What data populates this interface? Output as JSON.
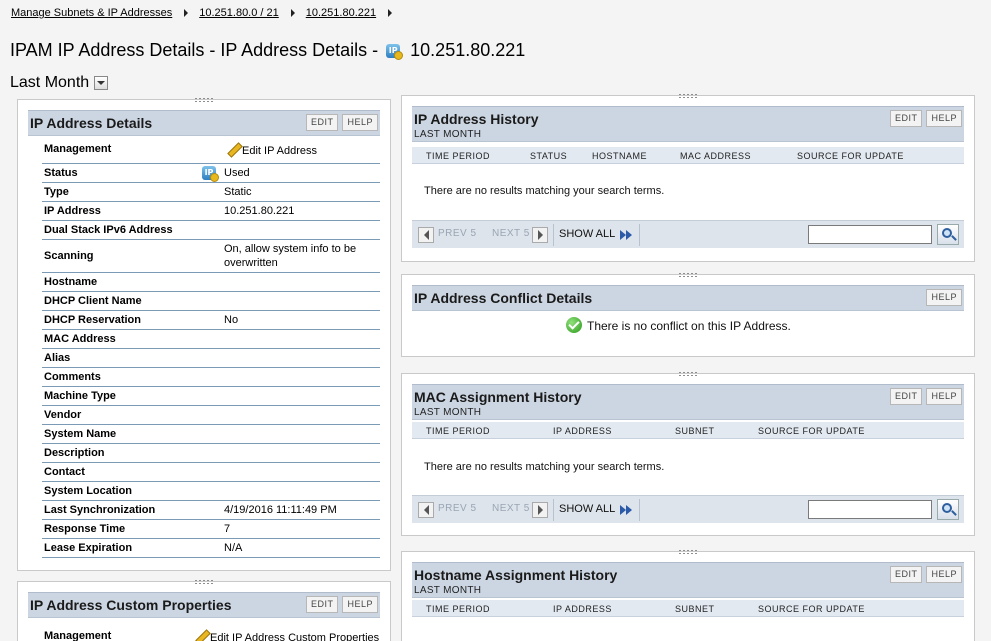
{
  "breadcrumb": [
    "Manage Subnets & IP Addresses",
    "10.251.80.0 / 21",
    "10.251.80.221"
  ],
  "page": {
    "title": "IPAM IP Address Details - IP Address Details -",
    "ip": "10.251.80.221",
    "ip_icon_label": "IP",
    "period": "Last Month"
  },
  "buttons": {
    "edit": "EDIT",
    "help": "HELP"
  },
  "details": {
    "title": "IP Address Details",
    "management_label": "Management",
    "management_link": "Edit IP Address",
    "rows": [
      {
        "key": "Status",
        "value": "Used"
      },
      {
        "key": "Type",
        "value": "Static"
      },
      {
        "key": "IP Address",
        "value": "10.251.80.221"
      },
      {
        "key": "Dual Stack IPv6 Address",
        "value": ""
      },
      {
        "key": "Scanning",
        "value": "On, allow system info to be overwritten"
      },
      {
        "key": "Hostname",
        "value": ""
      },
      {
        "key": "DHCP Client Name",
        "value": ""
      },
      {
        "key": "DHCP Reservation",
        "value": "No"
      },
      {
        "key": "MAC Address",
        "value": ""
      },
      {
        "key": "Alias",
        "value": ""
      },
      {
        "key": "Comments",
        "value": ""
      },
      {
        "key": "Machine Type",
        "value": ""
      },
      {
        "key": "Vendor",
        "value": ""
      },
      {
        "key": "System Name",
        "value": ""
      },
      {
        "key": "Description",
        "value": ""
      },
      {
        "key": "Contact",
        "value": ""
      },
      {
        "key": "System Location",
        "value": ""
      },
      {
        "key": "Last Synchronization",
        "value": "4/19/2016 11:11:49 PM"
      },
      {
        "key": "Response Time",
        "value": "7"
      },
      {
        "key": "Lease Expiration",
        "value": "N/A"
      }
    ]
  },
  "custom_props": {
    "title": "IP Address Custom Properties",
    "management_label": "Management",
    "management_link": "Edit IP Address Custom Properties"
  },
  "history": {
    "title": "IP Address History",
    "subtitle": "LAST MONTH",
    "columns": [
      "TIME PERIOD",
      "STATUS",
      "HOSTNAME",
      "MAC ADDRESS",
      "SOURCE FOR UPDATE"
    ],
    "empty": "There are no results matching your search terms."
  },
  "conflict": {
    "title": "IP Address Conflict Details",
    "message": "There is no conflict on this IP Address."
  },
  "mac": {
    "title": "MAC Assignment History",
    "subtitle": "LAST MONTH",
    "columns": [
      "TIME PERIOD",
      "IP ADDRESS",
      "SUBNET",
      "SOURCE FOR UPDATE"
    ],
    "empty": "There are no results matching your search terms."
  },
  "hostname": {
    "title": "Hostname Assignment History",
    "subtitle": "LAST MONTH",
    "columns": [
      "TIME PERIOD",
      "IP ADDRESS",
      "SUBNET",
      "SOURCE FOR UPDATE"
    ]
  },
  "pager": {
    "prev": "PREV 5",
    "next": "NEXT 5",
    "show_all": "SHOW ALL",
    "search_value": ""
  }
}
